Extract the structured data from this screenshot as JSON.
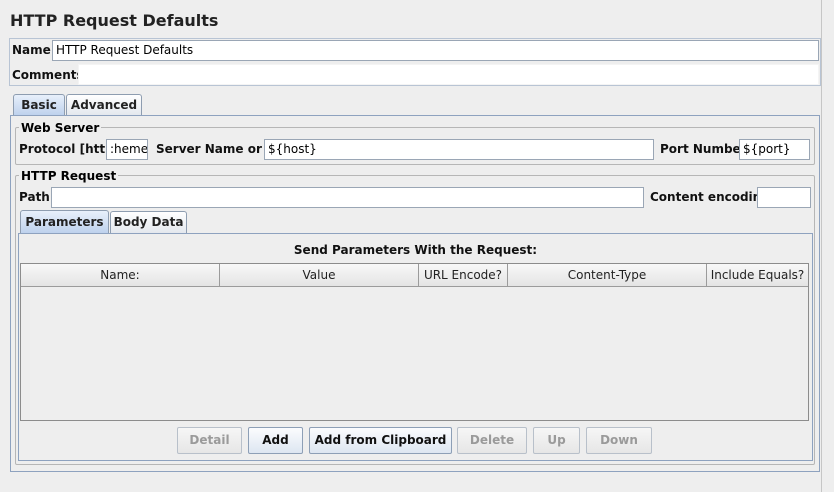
{
  "title": "HTTP Request Defaults",
  "name_field": {
    "label": "Name:",
    "value": "HTTP Request Defaults"
  },
  "comments_field": {
    "label": "Comments:",
    "value": ""
  },
  "main_tabs": [
    {
      "label": "Basic",
      "selected": true
    },
    {
      "label": "Advanced",
      "selected": false
    }
  ],
  "web_server": {
    "legend": "Web Server",
    "protocol_label": "Protocol [http]:",
    "protocol_value": ":heme}",
    "server_label": "Server Name or IP:",
    "server_value": "${host}",
    "port_label": "Port Number:",
    "port_value": "${port}"
  },
  "http_request": {
    "legend": "HTTP Request",
    "path_label": "Path:",
    "path_value": "",
    "encoding_label": "Content encoding:",
    "encoding_value": ""
  },
  "sub_tabs": [
    {
      "label": "Parameters",
      "selected": true
    },
    {
      "label": "Body Data",
      "selected": false
    }
  ],
  "params_table": {
    "caption": "Send Parameters With the Request:",
    "columns": [
      "Name:",
      "Value",
      "URL Encode?",
      "Content-Type",
      "Include Equals?"
    ],
    "rows": []
  },
  "buttons": [
    {
      "label": "Detail",
      "enabled": false
    },
    {
      "label": "Add",
      "enabled": true
    },
    {
      "label": "Add from Clipboard",
      "enabled": true
    },
    {
      "label": "Delete",
      "enabled": false
    },
    {
      "label": "Up",
      "enabled": false
    },
    {
      "label": "Down",
      "enabled": false
    }
  ]
}
